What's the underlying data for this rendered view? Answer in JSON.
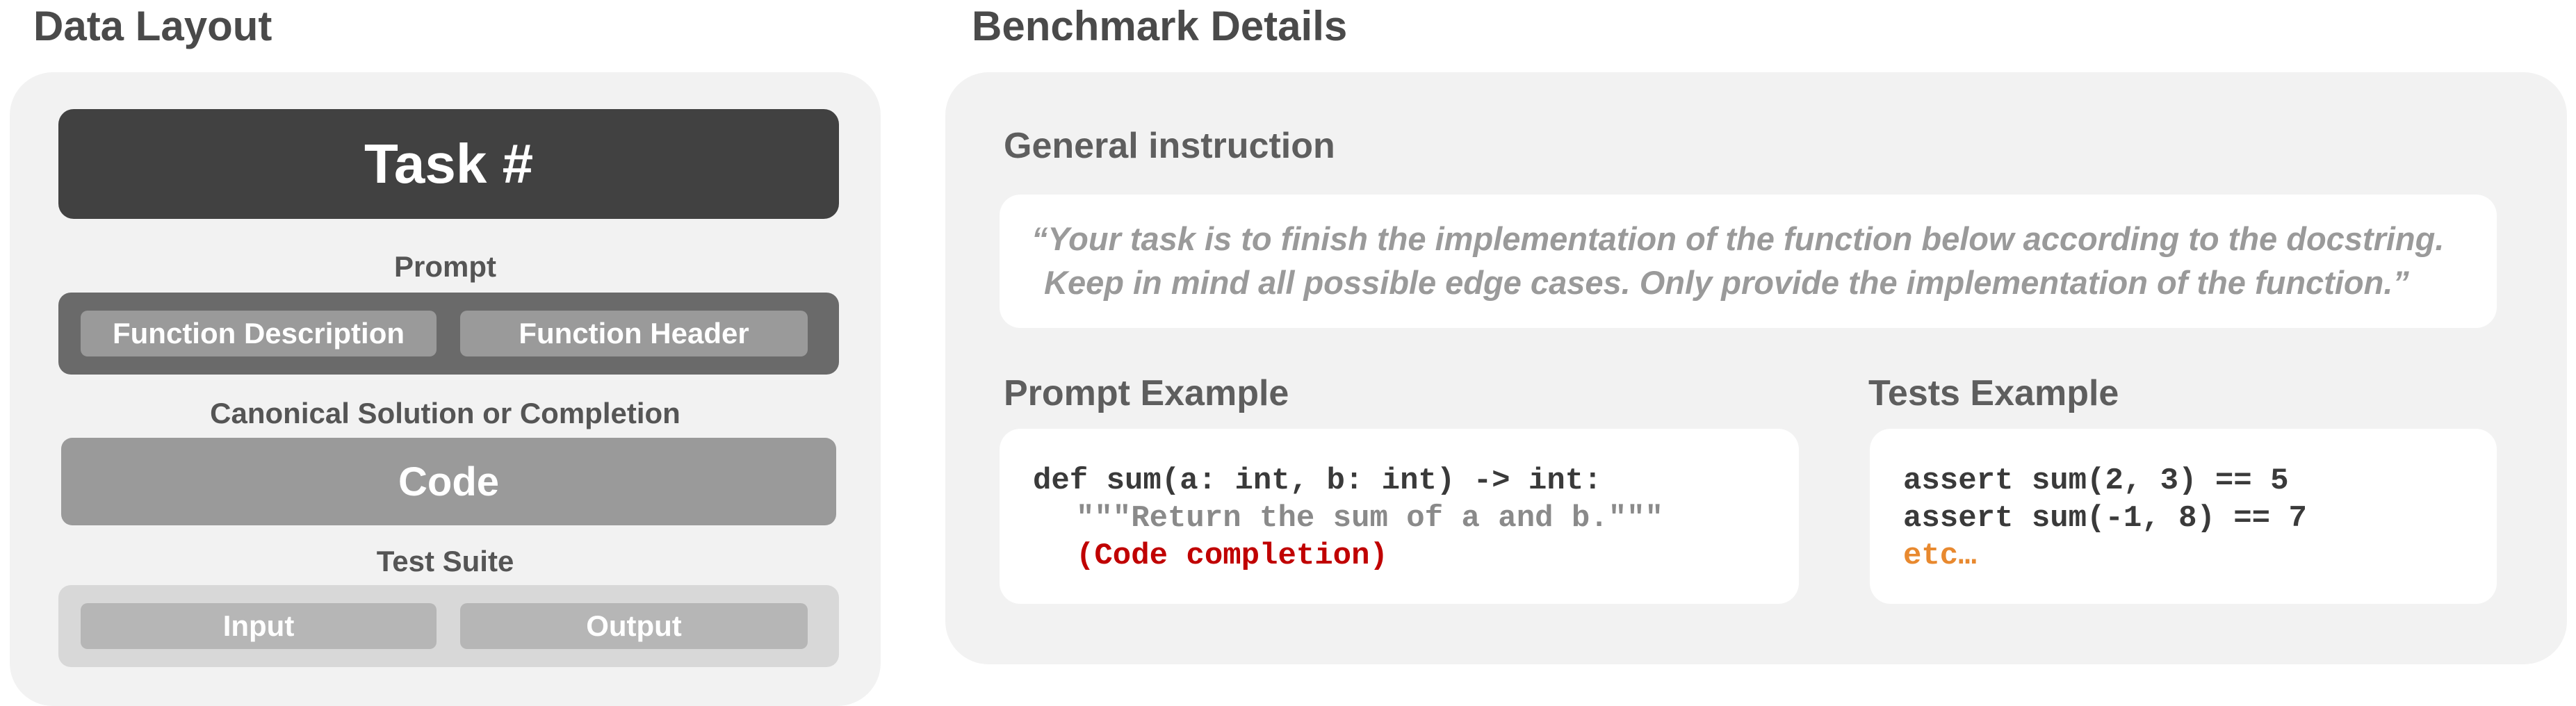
{
  "data_layout": {
    "title": "Data Layout",
    "task": "Task #",
    "prompt_label": "Prompt",
    "function_description": "Function Description",
    "function_header": "Function Header",
    "canonical_label": "Canonical Solution or Completion",
    "code": "Code",
    "test_suite_label": "Test Suite",
    "input": "Input",
    "output": "Output"
  },
  "benchmark": {
    "title": "Benchmark Details",
    "general_label": "General instruction",
    "instruction_line1": "“Your task is to finish the implementation of the function below according to the docstring.",
    "instruction_line2": "Keep in mind all possible edge cases. Only provide the implementation of the function.”",
    "prompt_example_label": "Prompt Example",
    "prompt_code": [
      "def sum(a: int, b: int) -> int:",
      "\"\"\"Return the sum of a and b.\"\"\"",
      "(Code completion)"
    ],
    "tests_example_label": "Tests Example",
    "tests_code": [
      "assert sum(2, 3) == 5",
      "assert sum(-1, 8) == 7",
      "etc…"
    ]
  },
  "colors": {
    "dark_box": "#414141",
    "completion_text": "#c00000",
    "etc_text": "#e8892f"
  }
}
